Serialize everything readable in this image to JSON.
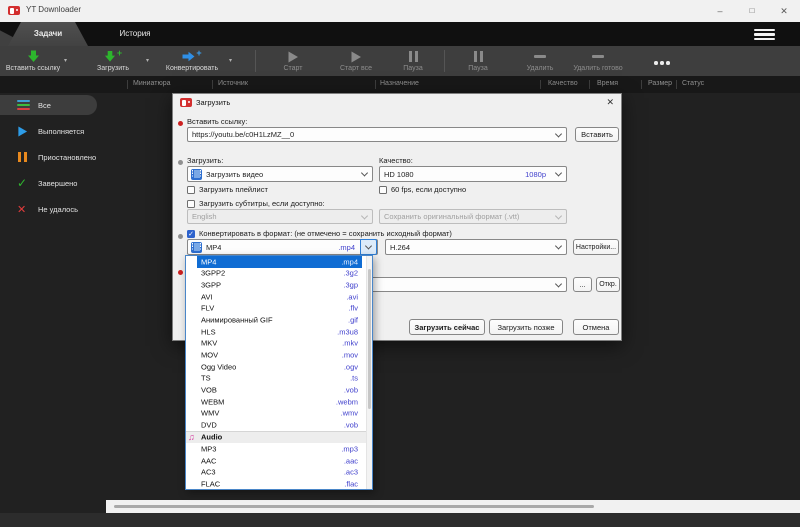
{
  "icons": {
    "minimize": "–",
    "maximize": "□",
    "close": "✕",
    "dialog_close": "✕",
    "caret_down": "▾",
    "check": "✓",
    "cross": "✕",
    "music_note": "♫",
    "plus": "+",
    "ellipsis": "•••",
    "hamburger": "≡"
  },
  "colors": {
    "accent_blue": "#0f6cd3",
    "extension_blue": "#4141cd",
    "download_green": "#2db52d",
    "convert_blue": "#2f8fe6",
    "paused_orange": "#e8891e",
    "app_red": "#d32f2f",
    "check_green": "#2fb52f",
    "fail_red": "#e23c3c",
    "checkbox_blue": "#2d62cc"
  },
  "titlebar": {
    "title": "YT Downloader"
  },
  "tabs": {
    "tasks": "Задачи",
    "history": "История"
  },
  "toolbar": {
    "paste_link": "Вставить ссылку",
    "download": "Загрузить",
    "convert": "Конвертировать",
    "start": "Старт",
    "start_all": "Старт все",
    "pause": "Пауза",
    "pause_all": "Пауза",
    "delete": "Удалить",
    "delete_done": "Удалить готово"
  },
  "table": {
    "columns": [
      "Миниатюра",
      "Источник",
      "Назначение",
      "Качество",
      "Время",
      "Размер",
      "Статус"
    ]
  },
  "sidebar": {
    "all": "Все",
    "running": "Выполняется",
    "paused": "Приостановлено",
    "completed": "Завершено",
    "failed": "Не удалось"
  },
  "dialog": {
    "title": "Загрузить",
    "paste_section_label": "Вставить ссылку:",
    "url_value": "https://youtu.be/c0H1LzMZ__0",
    "paste_button": "Вставить",
    "download_label": "Загрузить:",
    "quality_label": "Качество:",
    "download_type": "Загрузить видео",
    "quality_value": "HD 1080",
    "quality_tag": "1080p",
    "playlist_label": "Загрузить плейлист",
    "fps_label": "60 fps, если доступно",
    "subtitles_label": "Загрузить субтитры, если доступно:",
    "subtitle_language": "English",
    "subtitle_format": "Сохранить оригинальный формат (.vtt)",
    "convert_label": "Конвертировать в формат: (не отмечено = сохранить исходный формат)",
    "format_name": "MP4",
    "format_ext": ".mp4",
    "codec": "H.264",
    "settings_button": "Настройки...",
    "browse_button": "...",
    "open_button": "Откр.",
    "download_now": "Загрузить сейчас",
    "download_later": "Загрузить позже",
    "cancel": "Отмена"
  },
  "dropdown": {
    "selected_item": "MP4",
    "video_items": [
      {
        "name": "MP4",
        "ext": ".mp4"
      },
      {
        "name": "3GPP2",
        "ext": ".3g2"
      },
      {
        "name": "3GPP",
        "ext": ".3gp"
      },
      {
        "name": "AVI",
        "ext": ".avi"
      },
      {
        "name": "FLV",
        "ext": ".flv"
      },
      {
        "name": "Анимированный GIF",
        "ext": ".gif"
      },
      {
        "name": "HLS",
        "ext": ".m3u8"
      },
      {
        "name": "MKV",
        "ext": ".mkv"
      },
      {
        "name": "MOV",
        "ext": ".mov"
      },
      {
        "name": "Ogg Video",
        "ext": ".ogv"
      },
      {
        "name": "TS",
        "ext": ".ts"
      },
      {
        "name": "VOB",
        "ext": ".vob"
      },
      {
        "name": "WEBM",
        "ext": ".webm"
      },
      {
        "name": "WMV",
        "ext": ".wmv"
      },
      {
        "name": "DVD",
        "ext": ".vob"
      }
    ],
    "audio_header": "Audio",
    "audio_items": [
      {
        "name": "MP3",
        "ext": ".mp3"
      },
      {
        "name": "AAC",
        "ext": ".aac"
      },
      {
        "name": "AC3",
        "ext": ".ac3"
      },
      {
        "name": "FLAC",
        "ext": ".flac"
      }
    ]
  }
}
